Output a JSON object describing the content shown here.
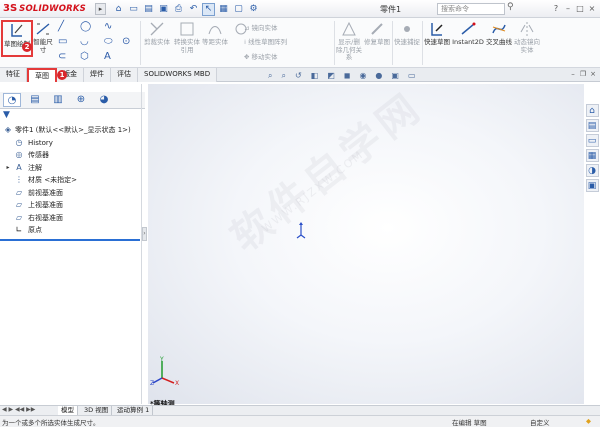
{
  "app": {
    "logo_mark": "3S",
    "logo_text": "SOLIDWORKS",
    "document_title": "零件1",
    "search_placeholder": "搜索命令"
  },
  "ribbon": {
    "sketch": "草图绘制",
    "smart_dim": "智能尺寸",
    "trim": "剪裁实体",
    "convert": "转换实体引用",
    "offset": "等距实体",
    "mirror": "镜向实体",
    "linear_pattern": "线性草图阵列",
    "move": "移动实体",
    "display_relations": "显示/删除几何关系",
    "repair": "修复草图",
    "quick_snap": "快速捕捉",
    "rapid_sketch": "快速草图",
    "instant2d": "Instant2D",
    "intersection_curve": "交叉曲线",
    "dynamic_mirror": "动态镜向实体"
  },
  "tabs": [
    "特征",
    "草图",
    "钣金",
    "焊件",
    "评估",
    "SOLIDWORKS MBD"
  ],
  "badges": {
    "one": "1",
    "two": "2"
  },
  "feature_tree": {
    "root": "零件1 (默认<<默认>_显示状态 1>)",
    "items": [
      "History",
      "传感器",
      "注解",
      "材质 <未指定>",
      "前视基准面",
      "上视基准面",
      "右视基准面",
      "原点"
    ]
  },
  "watermark": {
    "main": "软件自学网",
    "sub": "WWW.RJZXW.COM"
  },
  "viewport": {
    "view_label": "*等轴测"
  },
  "model_tabs": [
    "模型",
    "3D 视图",
    "运动算例 1"
  ],
  "status": {
    "hint": "为一个或多个所选实体生成尺寸。",
    "editing": "在编辑 草图",
    "custom": "自定义"
  },
  "colors": {
    "brand_red": "#d4101a",
    "highlight_red": "#e43a3a",
    "accent_blue": "#2a6fd4"
  }
}
